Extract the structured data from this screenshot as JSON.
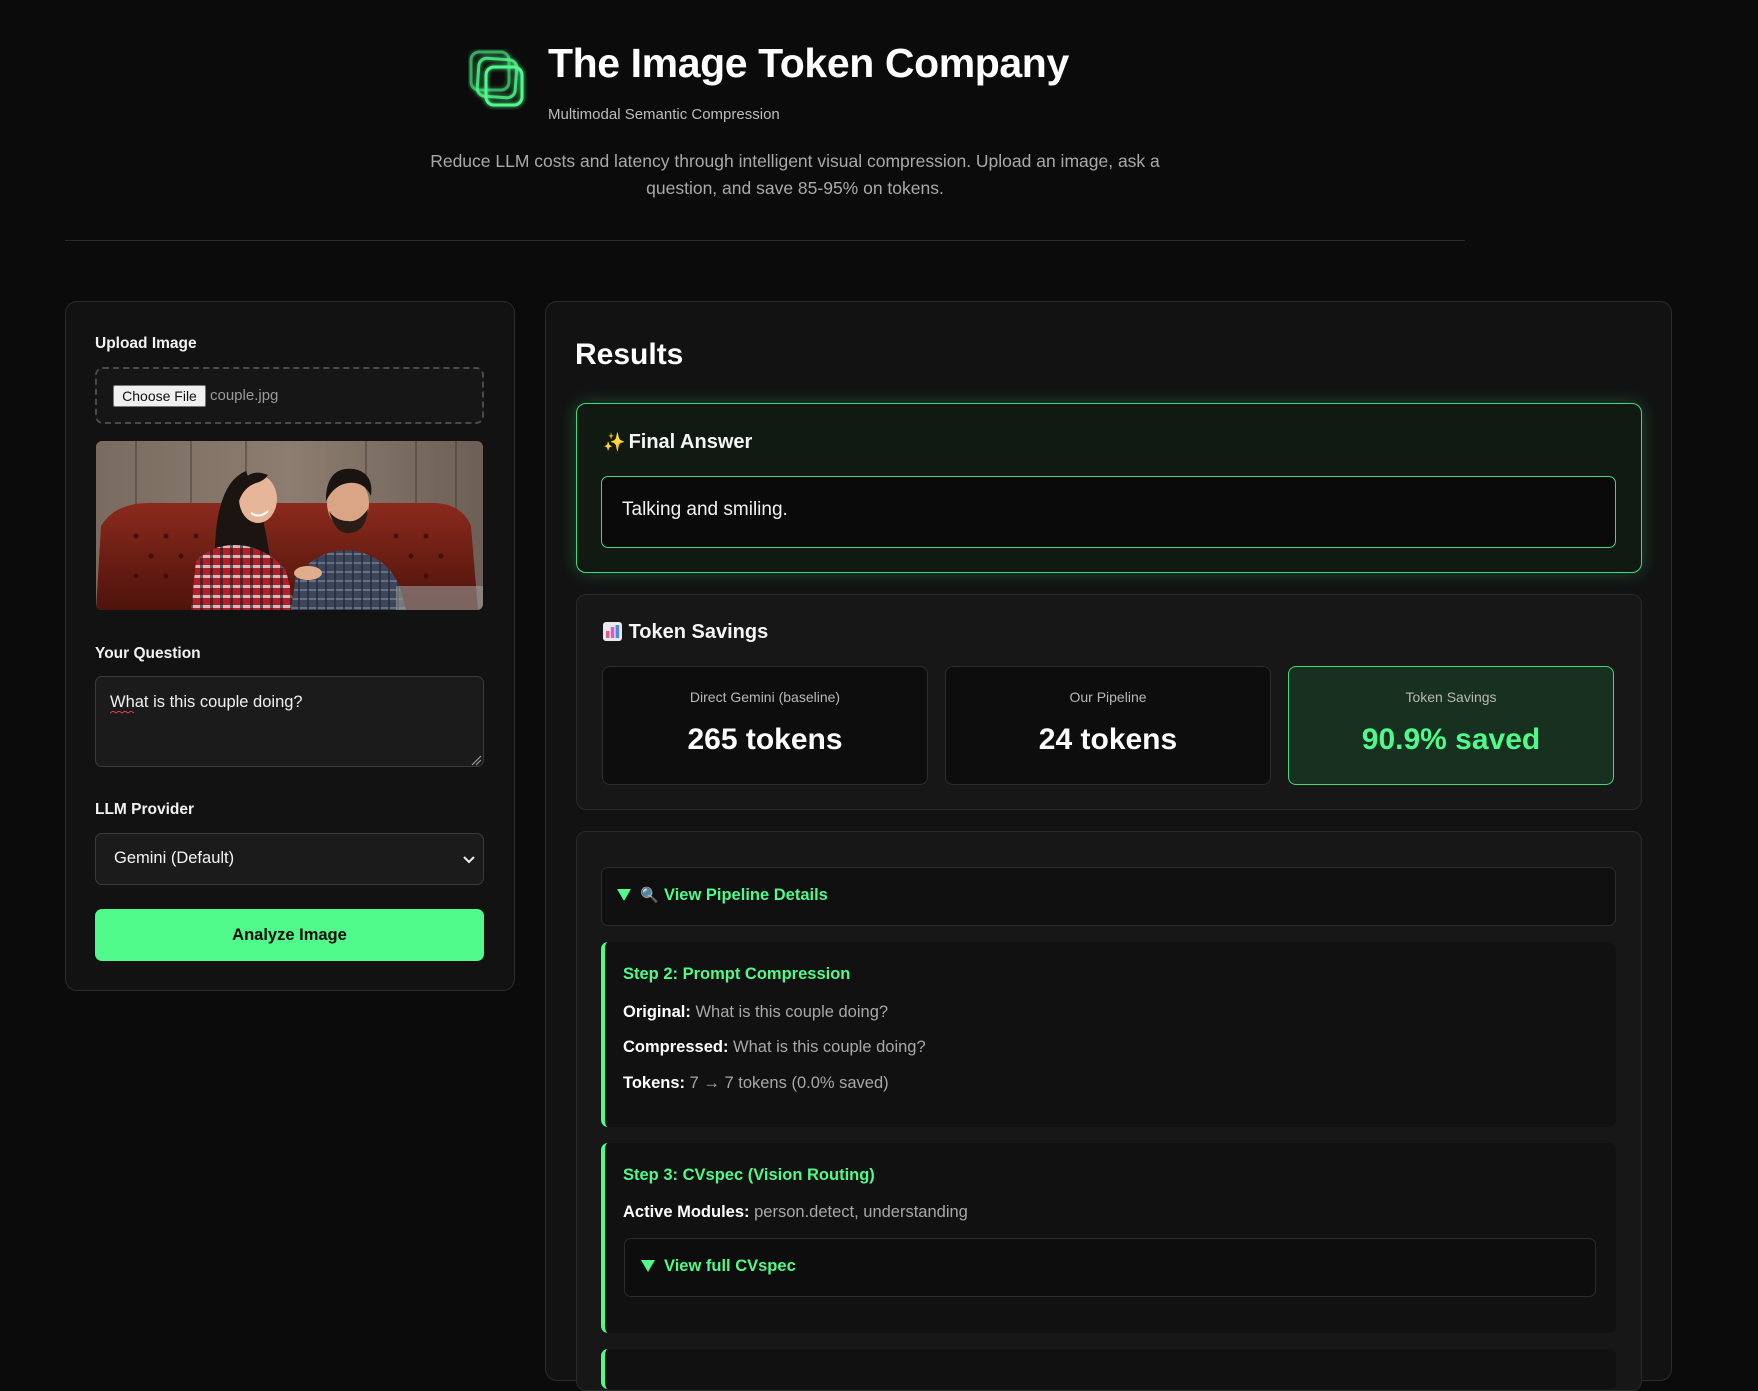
{
  "header": {
    "title": "The Image Token Company",
    "subtitle": "Multimodal Semantic Compression",
    "tagline": "Reduce LLM costs and latency through intelligent visual compression. Upload an image, ask a question, and save 85-95% on tokens."
  },
  "upload": {
    "label": "Upload Image",
    "button_label": "Choose File",
    "file_name": "couple.jpg"
  },
  "question": {
    "label": "Your Question",
    "value": "What is this couple doing?"
  },
  "provider": {
    "label": "LLM Provider",
    "selected": "Gemini (Default)"
  },
  "analyze_button": "Analyze Image",
  "results": {
    "title": "Results",
    "final_answer": {
      "icon": "sparkles-icon",
      "title": "Final Answer",
      "text": "Talking and smiling."
    },
    "token_savings": {
      "icon": "bar-chart-icon",
      "title": "Token Savings",
      "stats": [
        {
          "label": "Direct Gemini (baseline)",
          "value": "265 tokens"
        },
        {
          "label": "Our Pipeline",
          "value": "24 tokens"
        },
        {
          "label": "Token Savings",
          "value": "90.9% saved"
        }
      ]
    },
    "pipeline": {
      "toggle_icon": "magnifier-icon",
      "toggle_label": "View Pipeline Details",
      "step2": {
        "title": "Step 2: Prompt Compression",
        "original_label": "Original:",
        "original_value": "What is this couple doing?",
        "compressed_label": "Compressed:",
        "compressed_value": "What is this couple doing?",
        "tokens_label": "Tokens:",
        "tokens_value": "7 → 7 tokens (0.0% saved)"
      },
      "step3": {
        "title": "Step 3: CVspec (Vision Routing)",
        "modules_label": "Active Modules:",
        "modules_value": "person.detect, understanding",
        "toggle_label": "View full CVspec"
      }
    }
  },
  "colors": {
    "accent": "#4ff98a",
    "background": "#0b0b0b",
    "panel": "#121212"
  }
}
